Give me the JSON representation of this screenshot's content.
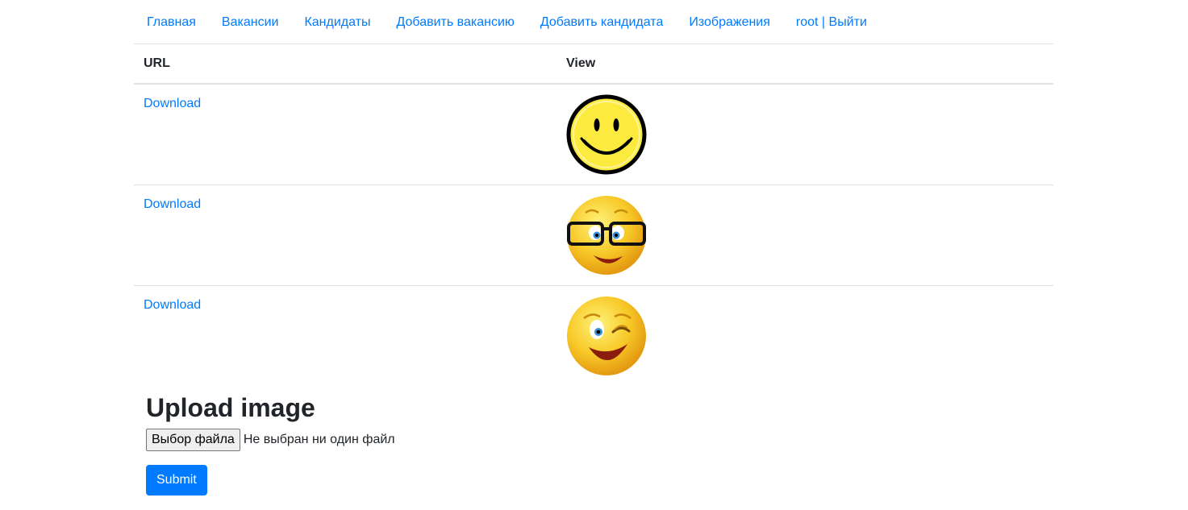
{
  "nav": {
    "items": [
      {
        "label": "Главная"
      },
      {
        "label": "Вакансии"
      },
      {
        "label": "Кандидаты"
      },
      {
        "label": "Добавить вакансию"
      },
      {
        "label": "Добавить кандидата"
      },
      {
        "label": "Изображения"
      },
      {
        "label": "root | Выйти"
      }
    ]
  },
  "table": {
    "headers": {
      "url": "URL",
      "view": "View"
    },
    "rows": [
      {
        "link": "Download",
        "image": "smiley-classic-icon"
      },
      {
        "link": "Download",
        "image": "smiley-glasses-icon"
      },
      {
        "link": "Download",
        "image": "smiley-wink-icon"
      }
    ]
  },
  "upload": {
    "title": "Upload image",
    "file_button": "Выбор файла",
    "file_status": "Не выбран ни один файл",
    "submit": "Submit"
  },
  "colors": {
    "link": "#007bff",
    "primary": "#007bff",
    "border": "#dee2e6"
  }
}
